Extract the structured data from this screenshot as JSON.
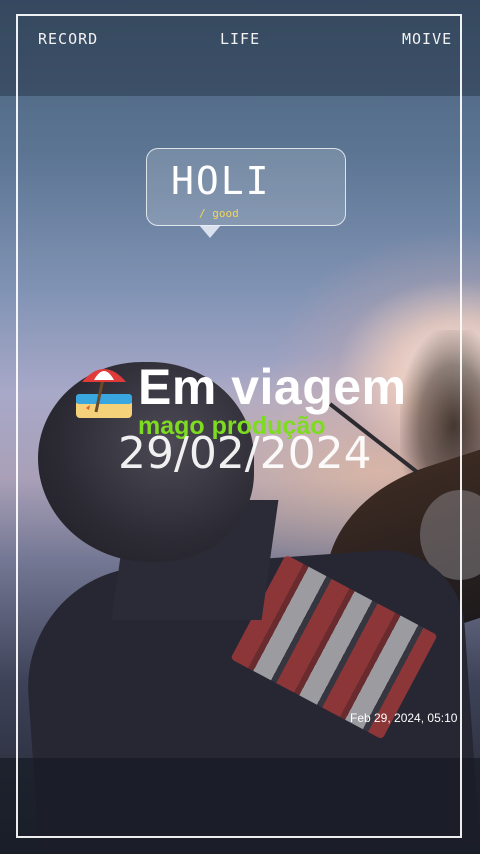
{
  "top_bar": {
    "left_label": "RECORD",
    "center_label": "LIFE",
    "right_label": "MOIVE"
  },
  "bubble": {
    "title": "HOLI",
    "subtitle": "/ good"
  },
  "overlay": {
    "emoji_icon": "beach-umbrella-icon",
    "headline": "Em viagem",
    "credit": "mago produção",
    "date_large": "29/02/2024"
  },
  "timestamp": "Feb 29, 2024, 05:10",
  "colors": {
    "frame": "#ffffff",
    "credit_green": "#7ddc1f",
    "subtitle_yellow": "#f1d65a"
  }
}
